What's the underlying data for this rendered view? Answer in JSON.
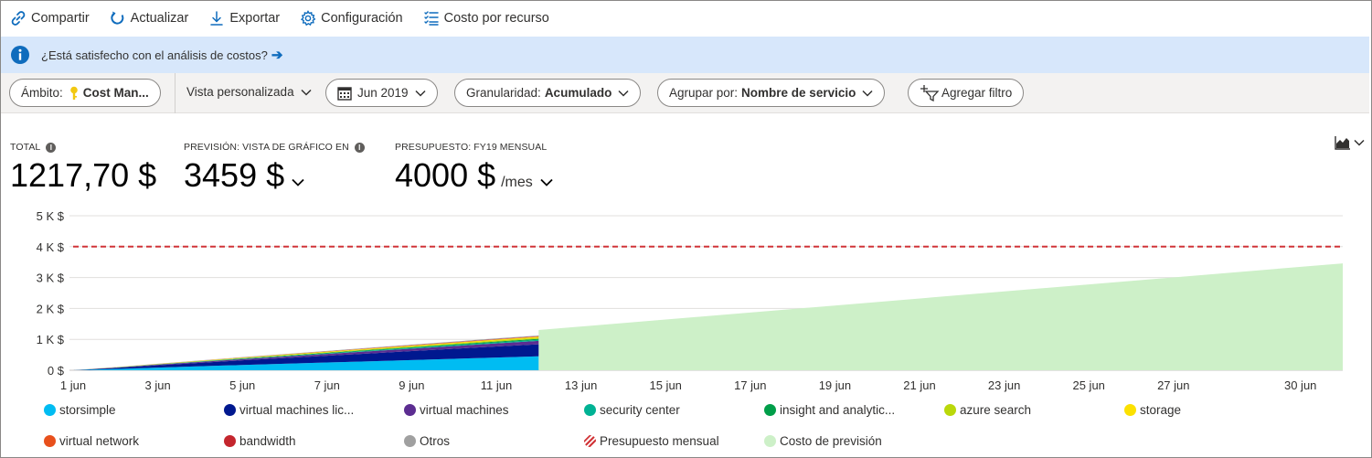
{
  "toolbar": {
    "share": "Compartir",
    "refresh": "Actualizar",
    "export": "Exportar",
    "settings": "Configuración",
    "cost_by_resource": "Costo por recurso"
  },
  "banner": {
    "text": "¿Está satisfecho con el análisis de costos?"
  },
  "filters": {
    "scope_label": "Ámbito:",
    "scope_value": "Cost Man...",
    "view": "Vista personalizada",
    "date": "Jun 2019",
    "granularity_label": "Granularidad:",
    "granularity_value": "Acumulado",
    "group_label": "Agrupar por:",
    "group_value": "Nombre de servicio",
    "add_filter": "Agregar filtro"
  },
  "kpis": {
    "total_label": "TOTAL",
    "total_value": "1217,70 $",
    "forecast_label": "PREVISIÓN: VISTA DE GRÁFICO EN",
    "forecast_value": "3459 $",
    "budget_label": "PRESUPUESTO: FY19 MENSUAL",
    "budget_value": "4000 $",
    "budget_unit": "/mes"
  },
  "colors": {
    "accent": "#0f6cbd",
    "budget_line": "#d13438",
    "forecast": "#cdf0c8"
  },
  "chart_data": {
    "type": "area",
    "y_ticks": [
      "0 $",
      "1 K $",
      "2 K $",
      "3 K $",
      "4 K $",
      "5 K $"
    ],
    "ylim": [
      0,
      5000
    ],
    "x_ticks": [
      "1 jun",
      "3 jun",
      "5 jun",
      "7 jun",
      "9 jun",
      "11 jun",
      "13 jun",
      "15 jun",
      "17 jun",
      "19 jun",
      "21 jun",
      "23 jun",
      "25 jun",
      "27 jun",
      "30 jun"
    ],
    "budget": 4000,
    "days": [
      0,
      1,
      2,
      3,
      4,
      5,
      6,
      7,
      8,
      9,
      10,
      11
    ],
    "series": [
      {
        "name": "storsimple",
        "color": "#00bcf2",
        "values": [
          0,
          40,
          85,
          130,
          170,
          210,
          250,
          290,
          330,
          370,
          410,
          450
        ]
      },
      {
        "name": "virtual machines lic...",
        "color": "#00188f",
        "values": [
          0,
          35,
          75,
          110,
          150,
          185,
          220,
          255,
          290,
          325,
          360,
          390
        ]
      },
      {
        "name": "virtual machines",
        "color": "#5c2d91",
        "values": [
          0,
          10,
          20,
          30,
          40,
          50,
          60,
          70,
          80,
          90,
          100,
          110
        ]
      },
      {
        "name": "security center",
        "color": "#00b294",
        "values": [
          0,
          3,
          6,
          9,
          12,
          15,
          18,
          21,
          24,
          27,
          30,
          33
        ]
      },
      {
        "name": "insight and analytic...",
        "color": "#009e49",
        "values": [
          0,
          3,
          6,
          9,
          12,
          15,
          18,
          21,
          24,
          27,
          30,
          33
        ]
      },
      {
        "name": "azure search",
        "color": "#bad80a",
        "values": [
          0,
          3,
          6,
          9,
          12,
          15,
          18,
          21,
          24,
          27,
          30,
          33
        ]
      },
      {
        "name": "storage",
        "color": "#fce100",
        "values": [
          0,
          3,
          6,
          9,
          12,
          15,
          18,
          21,
          24,
          27,
          30,
          33
        ]
      },
      {
        "name": "virtual network",
        "color": "#e8501c",
        "values": [
          0,
          1,
          2,
          3,
          4,
          5,
          6,
          7,
          8,
          9,
          10,
          11
        ]
      },
      {
        "name": "bandwidth",
        "color": "#c4262e",
        "values": [
          0,
          1,
          2,
          3,
          4,
          5,
          6,
          7,
          8,
          9,
          10,
          11
        ]
      },
      {
        "name": "Otros",
        "color": "#a0a0a0",
        "values": [
          0,
          2,
          4,
          6,
          8,
          10,
          12,
          14,
          16,
          18,
          20,
          22
        ]
      }
    ],
    "forecast_series": {
      "name": "Costo de previsión",
      "start_day": 11,
      "end_day": 30,
      "start_value": 1300,
      "end_value": 3459
    },
    "budget_series": {
      "name": "Presupuesto mensual"
    }
  }
}
